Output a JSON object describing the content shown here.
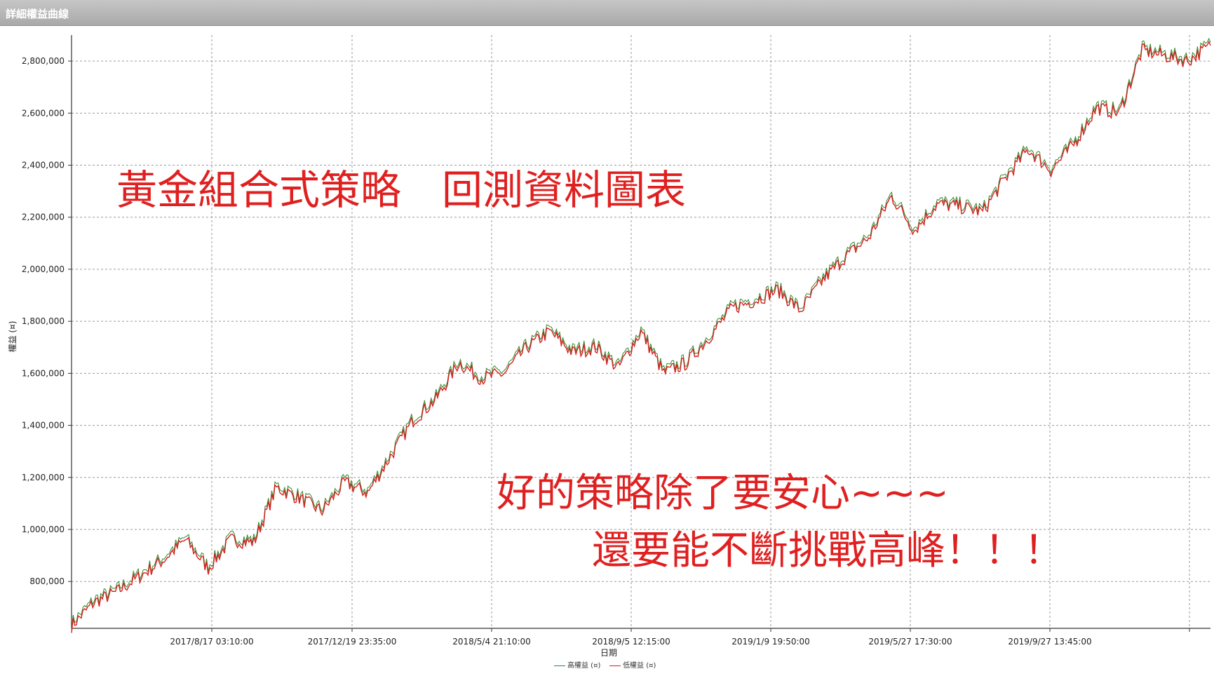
{
  "window": {
    "title": "詳細權益曲線"
  },
  "overlay_texts": {
    "heading": "黃金組合式策略　回測資料圖表",
    "line1": "好的策略除了要安心~~~",
    "line2": "還要能不斷挑戰高峰！！！"
  },
  "chart_data": {
    "type": "line",
    "xlabel": "日期",
    "ylabel": "權益 (¤)",
    "ylim": [
      620000,
      2900000
    ],
    "yticks": [
      800000,
      1000000,
      1200000,
      1400000,
      1600000,
      1800000,
      2000000,
      2200000,
      2400000,
      2600000,
      2800000
    ],
    "ytick_labels": [
      "800,000",
      "1,000,000",
      "1,200,000",
      "1,400,000",
      "1,600,000",
      "1,800,000",
      "2,000,000",
      "2,200,000",
      "2,400,000",
      "2,600,000",
      "2,800,000"
    ],
    "xtick_labels": [
      "2017/8/17 03:10:00",
      "2017/12/19 23:35:00",
      "2018/5/4 21:10:00",
      "2018/9/5 12:15:00",
      "2019/1/9 19:50:00",
      "2019/5/27 17:30:00",
      "2019/9/27 13:45:00"
    ],
    "grid": true,
    "legend_position": "bottom-center",
    "series": [
      {
        "name": "高權益 (¤)",
        "color": "#2e8b2e"
      },
      {
        "name": "低權益 (¤)",
        "color": "#d62020"
      }
    ],
    "x": [
      0,
      0.02,
      0.04,
      0.06,
      0.08,
      0.1,
      0.12,
      0.14,
      0.16,
      0.18,
      0.2,
      0.22,
      0.24,
      0.26,
      0.28,
      0.3,
      0.32,
      0.34,
      0.36,
      0.38,
      0.4,
      0.42,
      0.44,
      0.46,
      0.48,
      0.5,
      0.52,
      0.54,
      0.56,
      0.58,
      0.6,
      0.62,
      0.64,
      0.66,
      0.68,
      0.7,
      0.72,
      0.74,
      0.76,
      0.78,
      0.8,
      0.82,
      0.84,
      0.86,
      0.88,
      0.9,
      0.92,
      0.94,
      0.96,
      0.98,
      1.0
    ],
    "values": [
      630000,
      720000,
      760000,
      820000,
      880000,
      960000,
      850000,
      960000,
      950000,
      1160000,
      1120000,
      1070000,
      1180000,
      1140000,
      1280000,
      1420000,
      1500000,
      1640000,
      1580000,
      1600000,
      1700000,
      1760000,
      1680000,
      1700000,
      1620000,
      1760000,
      1600000,
      1640000,
      1740000,
      1850000,
      1880000,
      1920000,
      1840000,
      1960000,
      2050000,
      2120000,
      2280000,
      2150000,
      2250000,
      2240000,
      2220000,
      2350000,
      2460000,
      2380000,
      2480000,
      2620000,
      2600000,
      2840000,
      2820000,
      2800000,
      2860000
    ]
  }
}
